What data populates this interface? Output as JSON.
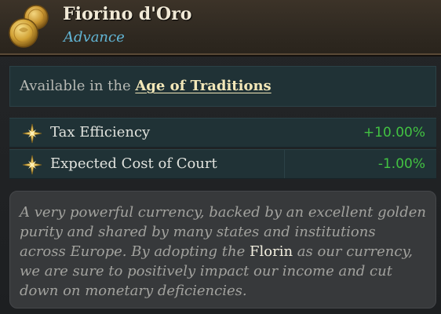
{
  "header": {
    "icon": "gold-coins-icon",
    "title": "Fiorino d'Oro",
    "subtitle": "Advance"
  },
  "availability": {
    "prefix": "Available in the ",
    "age_link": "Age of Traditions"
  },
  "modifiers": [
    {
      "icon": "star-icon",
      "label": "Tax Efficiency",
      "value": "+10.00%"
    },
    {
      "icon": "star-icon",
      "label": "Expected Cost of Court",
      "value": "-1.00%"
    }
  ],
  "description": {
    "before": "A very powerful currency, backed by an excellent golden purity and shared by many states and institutions across Europe. By adopting the ",
    "highlight": "Florin",
    "after": " as our currency, we are sure to positively impact our income and cut down on monetary deficiencies."
  },
  "colors": {
    "positive": "#42c242",
    "subtitle": "#62b6d6",
    "link": "#f2e7b8"
  }
}
